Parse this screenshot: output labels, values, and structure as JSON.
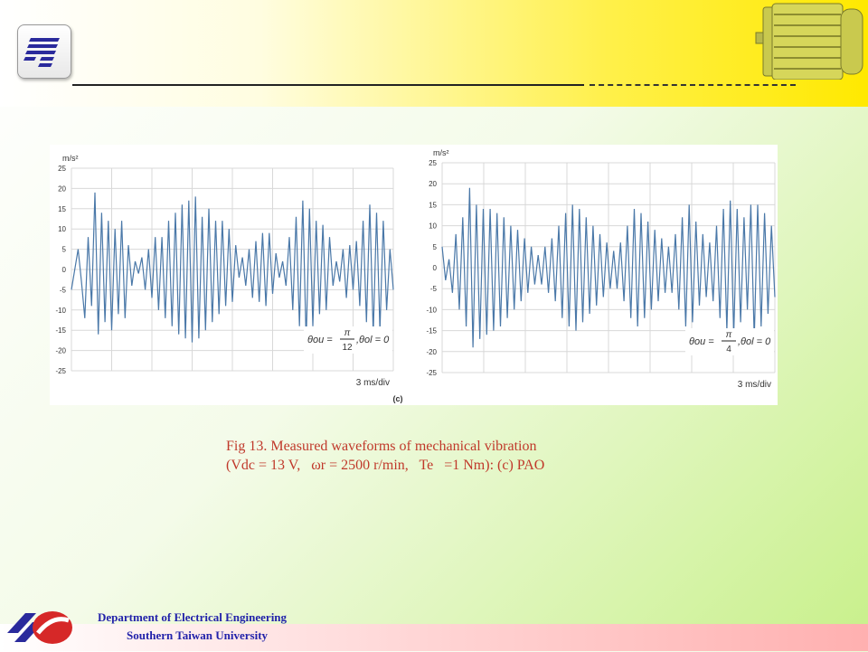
{
  "caption": {
    "line1": "Fig 13. Measured waveforms of mechanical vibration",
    "line2": "(Vdc = 13 V,   ωr = 2500 r/min,   Te   =1 Nm): (c) PAO"
  },
  "footer": {
    "department": "Department of Electrical Engineering",
    "university": "Southern Taiwan University"
  },
  "panel_label": "(c)",
  "colors": {
    "waveform": "#4a78a8",
    "caption": "#c0392b",
    "footer_text": "#2222aa"
  },
  "icons": {
    "top_logo": "stust-logo-icon",
    "motor": "motor-icon",
    "bottom_logo": "university-emblem-icon"
  },
  "chart_data": [
    {
      "type": "line",
      "ylabel": "m/s²",
      "xlabel": "3 ms/div",
      "annotation": {
        "lhs": "θou =",
        "num": "π",
        "den": "12",
        "rhs": ",θol = 0"
      },
      "ylim": [
        -25,
        25
      ],
      "yticks": [
        25,
        20,
        15,
        10,
        5,
        0,
        -5,
        -10,
        -15,
        -20,
        -25
      ],
      "grid": true,
      "x_divisions": 8,
      "series": [
        {
          "values": [
            -5,
            0,
            5,
            -3,
            -12,
            8,
            -9,
            19,
            -16,
            14,
            -13,
            12,
            -15,
            10,
            -11,
            12,
            -12,
            6,
            -4,
            2,
            -1,
            3,
            -5,
            5,
            -7,
            8,
            -10,
            8,
            -12,
            12,
            -14,
            14,
            -16,
            16,
            -17,
            17,
            -18,
            18,
            -17,
            13,
            -15,
            15,
            -13,
            12,
            -11,
            12,
            -9,
            10,
            -8,
            6,
            -2,
            3,
            -4,
            5,
            -7,
            7,
            -8,
            9,
            -9,
            9,
            -6,
            4,
            -2,
            2,
            -4,
            8,
            -10,
            13,
            -14,
            17,
            -18,
            15,
            -14,
            12,
            -11,
            11,
            -10,
            8,
            -4,
            2,
            -3,
            5,
            -7,
            6,
            -5,
            7,
            -9,
            12,
            -13,
            16,
            -16,
            14,
            -15,
            12,
            -10,
            5,
            -5
          ]
        }
      ]
    },
    {
      "type": "line",
      "ylabel": "m/s²",
      "xlabel": "3 ms/div",
      "annotation": {
        "lhs": "θou =",
        "num": "π",
        "den": "4",
        "rhs": ",θol = 0"
      },
      "ylim": [
        -25,
        25
      ],
      "yticks": [
        25,
        20,
        15,
        10,
        5,
        0,
        -5,
        -10,
        -15,
        -20,
        -25
      ],
      "grid": true,
      "x_divisions": 8,
      "series": [
        {
          "values": [
            5,
            -3,
            2,
            -6,
            8,
            -10,
            12,
            -14,
            19,
            -19,
            15,
            -17,
            14,
            -16,
            14,
            -15,
            13,
            -14,
            12,
            -12,
            10,
            -10,
            9,
            -8,
            7,
            -6,
            5,
            -4,
            3,
            -4,
            5,
            -6,
            7,
            -8,
            10,
            -12,
            13,
            -14,
            15,
            -15,
            14,
            -13,
            12,
            -11,
            10,
            -9,
            8,
            -7,
            6,
            -5,
            4,
            -5,
            6,
            -8,
            10,
            -12,
            14,
            -14,
            13,
            -12,
            11,
            -10,
            9,
            -8,
            7,
            -6,
            5,
            -6,
            8,
            -10,
            12,
            -14,
            15,
            -13,
            11,
            -9,
            8,
            -7,
            6,
            -8,
            10,
            -12,
            14,
            -15,
            16,
            -16,
            14,
            -13,
            12,
            -10,
            15,
            -17,
            15,
            -14,
            13,
            -11,
            10,
            -7
          ]
        }
      ]
    }
  ]
}
